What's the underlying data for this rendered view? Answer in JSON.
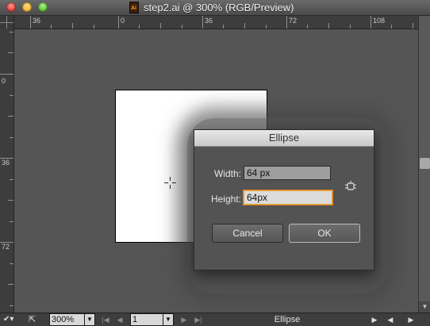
{
  "window": {
    "title": "step2.ai @ 300% (RGB/Preview)",
    "doc_icon_label": "Ai"
  },
  "ruler": {
    "horizontal_labels": [
      "36",
      "0",
      "36",
      "72",
      "108"
    ],
    "vertical_labels": [
      "0",
      "36",
      "72"
    ]
  },
  "dialog": {
    "title": "Ellipse",
    "width_label": "Width:",
    "width_value": "64 px",
    "height_label": "Height:",
    "height_value": "64px",
    "cancel_label": "Cancel",
    "ok_label": "OK"
  },
  "status": {
    "zoom": "300%",
    "page": "1",
    "tool": "Ellipse"
  },
  "icons": {
    "link": "link-constrain-icon",
    "cursor": "crosshair-cursor-icon"
  },
  "colors": {
    "canvas": "#555555",
    "focus_ring": "#e8a33a"
  }
}
